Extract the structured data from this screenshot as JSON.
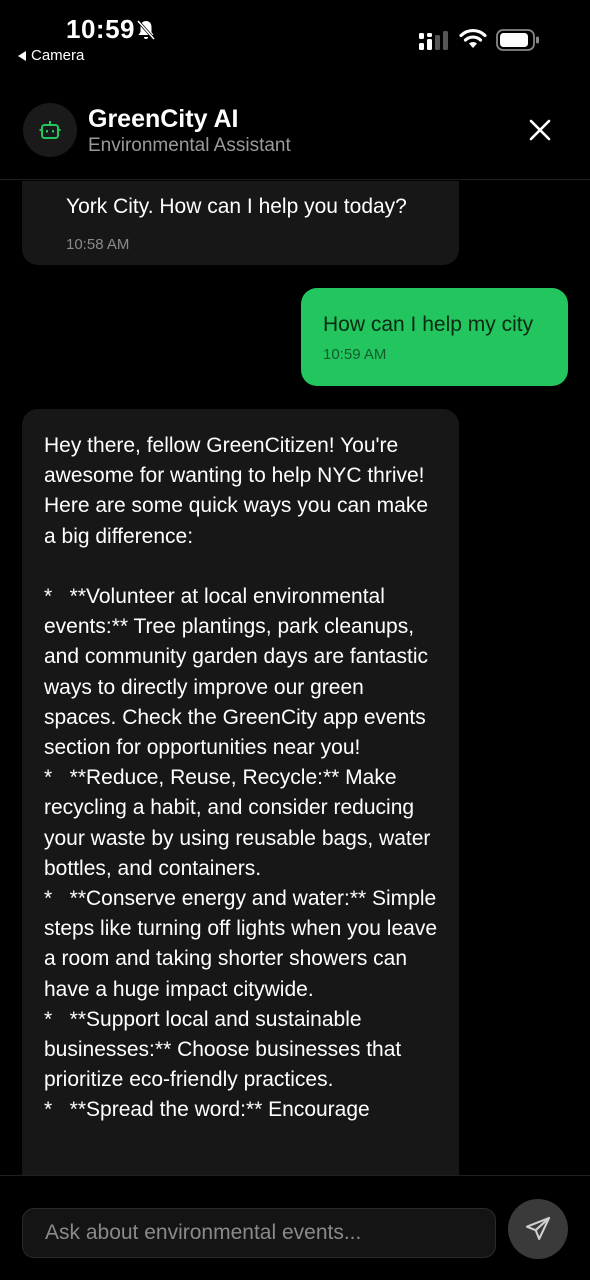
{
  "status_bar": {
    "time": "10:59",
    "back_app": "Camera",
    "icons": [
      "bell-slash-icon",
      "signal-icon",
      "wifi-icon",
      "battery-icon"
    ]
  },
  "header": {
    "title": "GreenCity AI",
    "subtitle": "Environmental Assistant",
    "avatar_icon": "robot-icon",
    "close_icon": "close-icon"
  },
  "messages": [
    {
      "sender": "bot",
      "lines": [
        "York City. How can I help you today?"
      ],
      "time": "10:58 AM"
    },
    {
      "sender": "user",
      "text": "How can I help my city",
      "time": "10:59 AM"
    },
    {
      "sender": "bot",
      "text": "Hey there, fellow GreenCitizen! You're awesome for wanting to help NYC thrive! Here are some quick ways you can make a big difference:\n\n*   **Volunteer at local environmental events:** Tree plantings, park cleanups, and community garden days are fantastic ways to directly improve our green spaces. Check the GreenCity app events section for opportunities near you!\n*   **Reduce, Reuse, Recycle:** Make recycling a habit, and consider reducing your waste by using reusable bags, water bottles, and containers.\n*   **Conserve energy and water:** Simple steps like turning off lights when you leave a room and taking shorter showers can have a huge impact citywide.\n*   **Support local and sustainable businesses:** Choose businesses that prioritize eco-friendly practices.\n*   **Spread the word:** Encourage"
    }
  ],
  "composer": {
    "placeholder": "Ask about environmental events...",
    "send_icon": "send-icon"
  },
  "colors": {
    "background": "#000000",
    "bot_bubble": "#171717",
    "user_bubble": "#22c55e",
    "accent": "#22c55e",
    "send_button": "#3a3a3a"
  }
}
